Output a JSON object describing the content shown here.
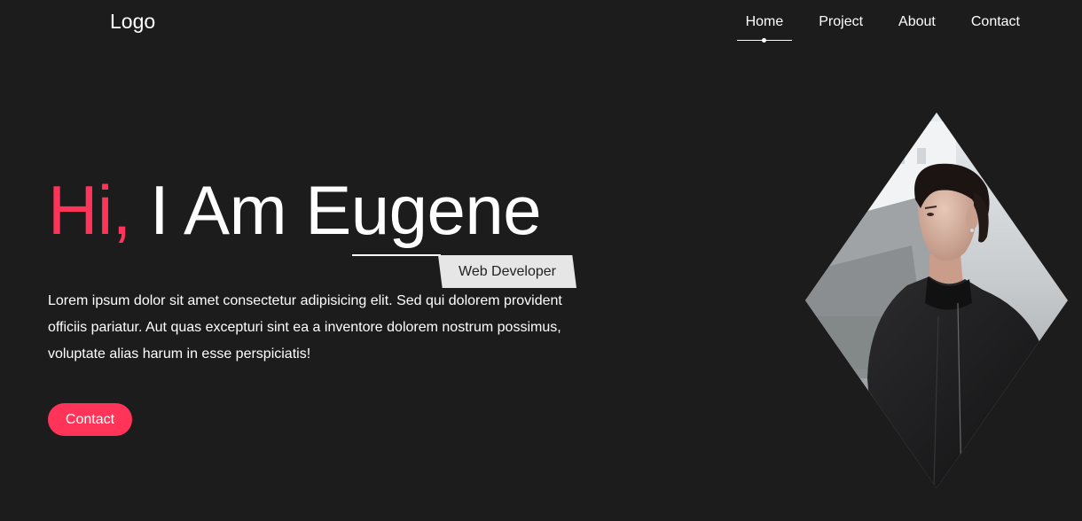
{
  "header": {
    "logo": "Logo",
    "nav": [
      {
        "label": "Home",
        "active": true
      },
      {
        "label": "Project",
        "active": false
      },
      {
        "label": "About",
        "active": false
      },
      {
        "label": "Contact",
        "active": false
      }
    ]
  },
  "hero": {
    "greeting": "Hi,",
    "name": "I Am Eugene",
    "role": "Web Developer",
    "description": "Lorem ipsum dolor sit amet consectetur adipisicing elit. Sed qui dolorem provident officiis pariatur. Aut quas excepturi sint ea a inventore dolorem nostrum possimus, voluptate alias harum in esse perspiciatis!",
    "cta_label": "Contact"
  },
  "colors": {
    "background": "#1c1c1c",
    "accent": "#ff3458",
    "text": "#ffffff",
    "tag_bg": "#e6e6e6"
  }
}
